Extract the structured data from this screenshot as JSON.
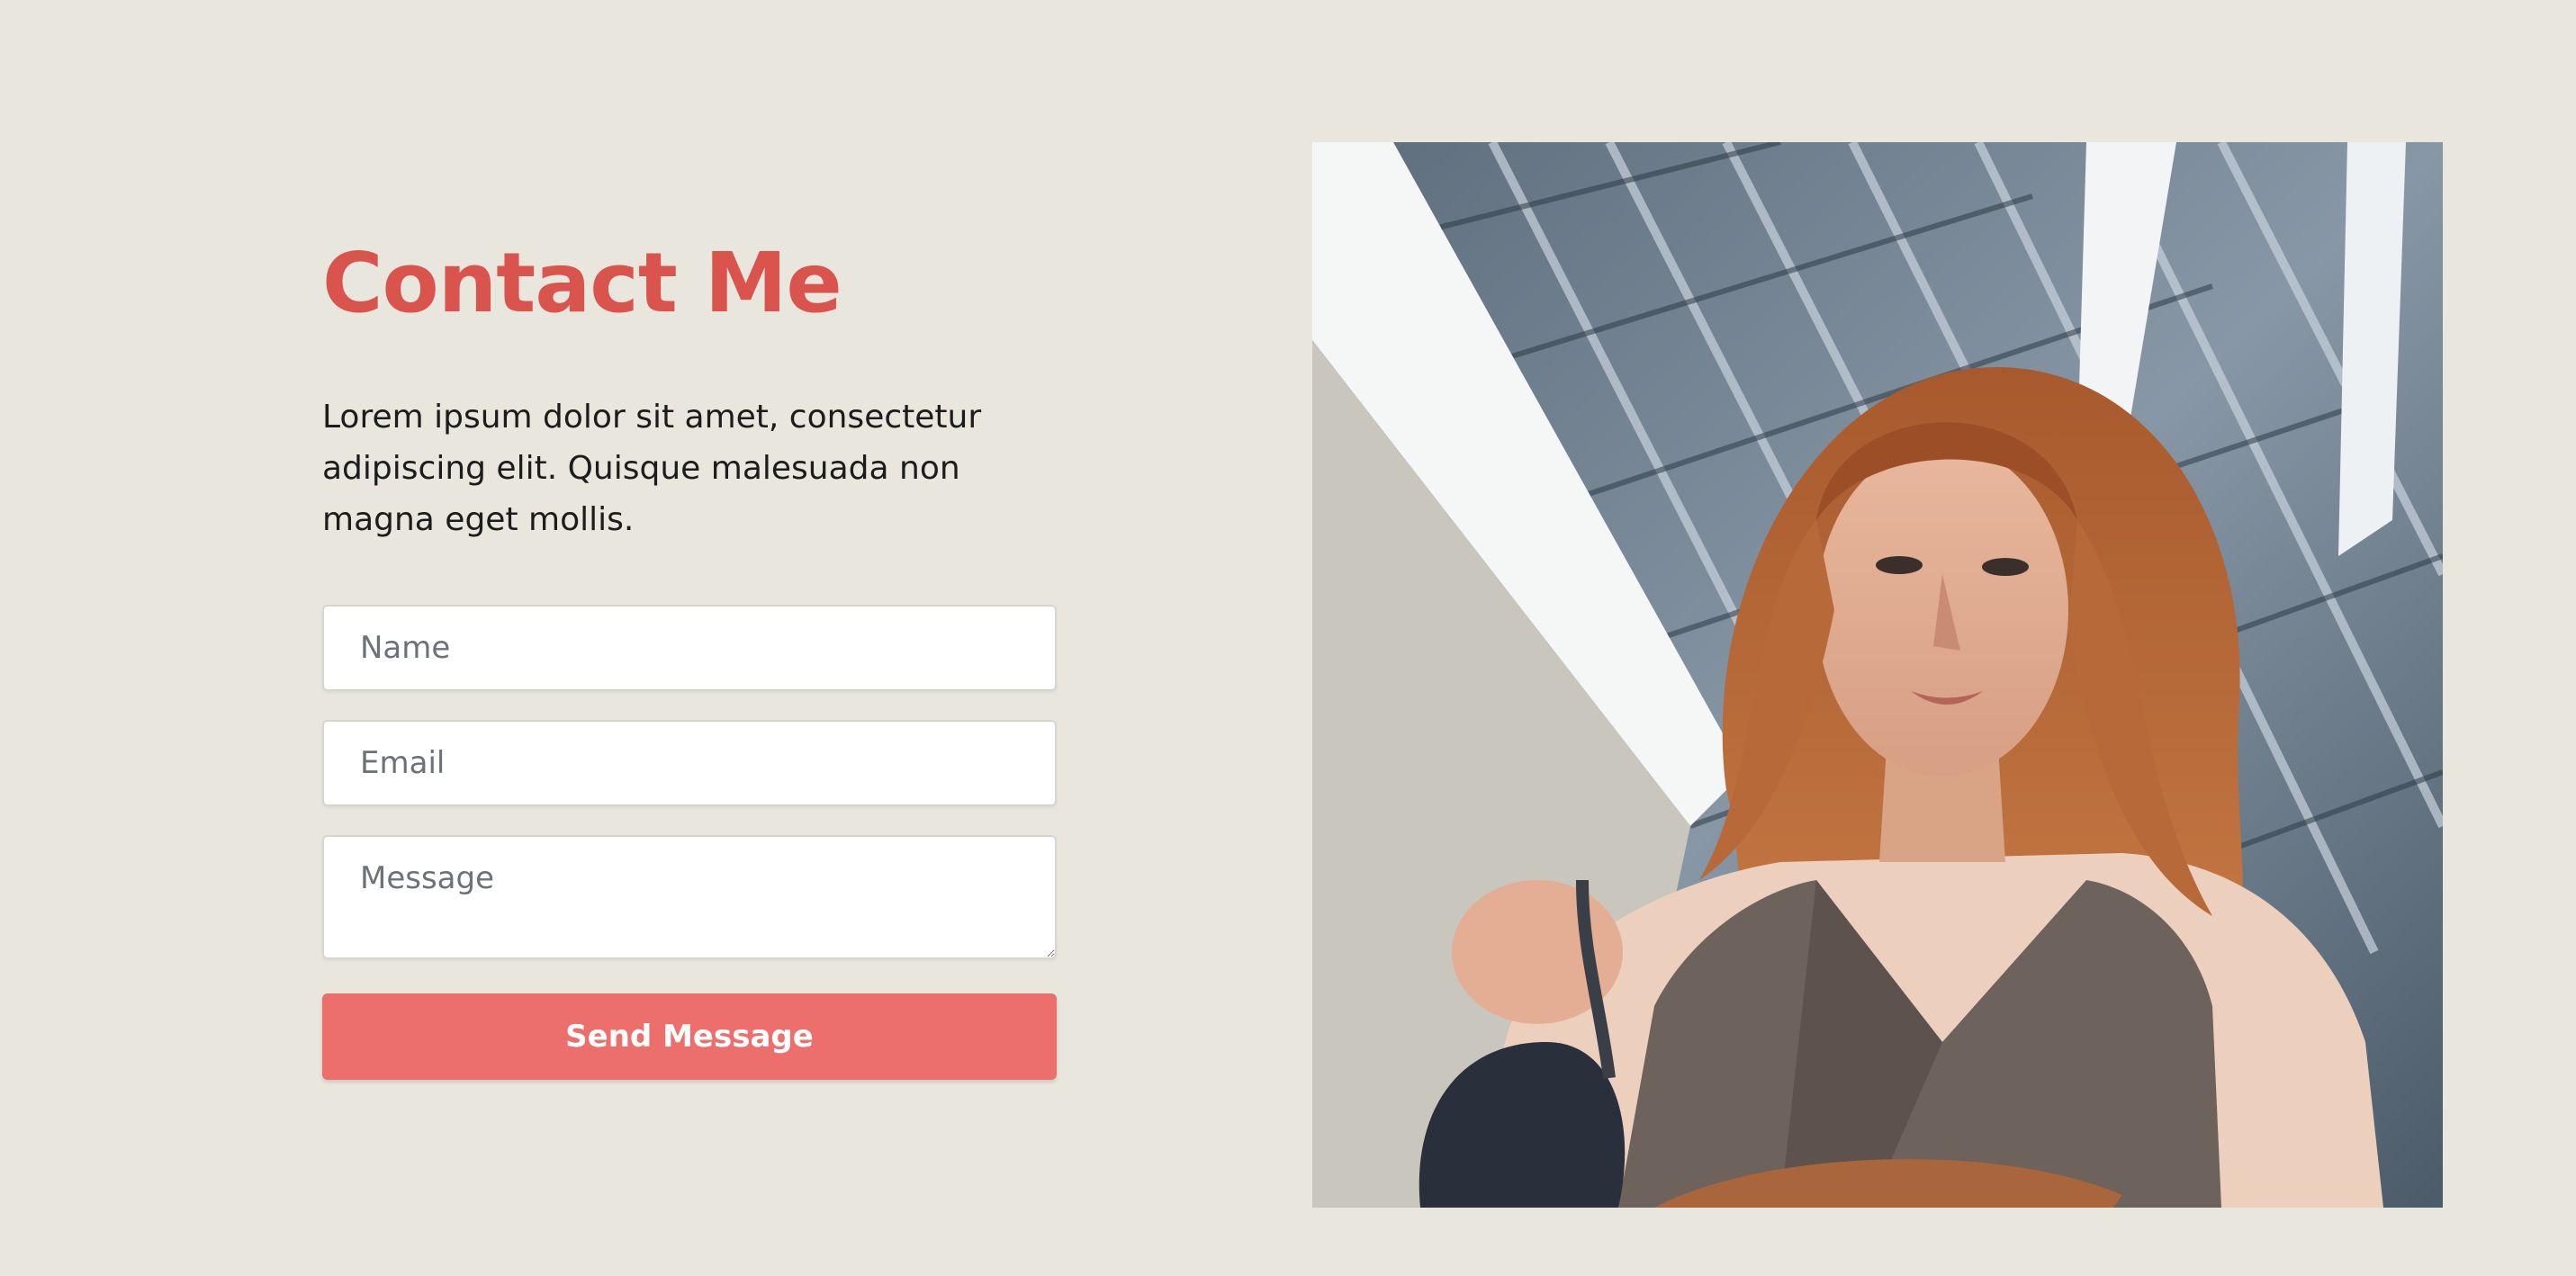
{
  "contact": {
    "title": "Contact Me",
    "intro": "Lorem ipsum dolor sit amet, consectetur adipiscing elit. Quisque malesuada non magna eget mollis.",
    "form": {
      "name_placeholder": "Name",
      "email_placeholder": "Email",
      "message_placeholder": "Message",
      "submit_label": "Send Message"
    }
  },
  "colors": {
    "background": "#e9e6de",
    "title": "#d9544d",
    "button": "#ec6f6b"
  },
  "photo": {
    "icon": "portrait-photo"
  }
}
